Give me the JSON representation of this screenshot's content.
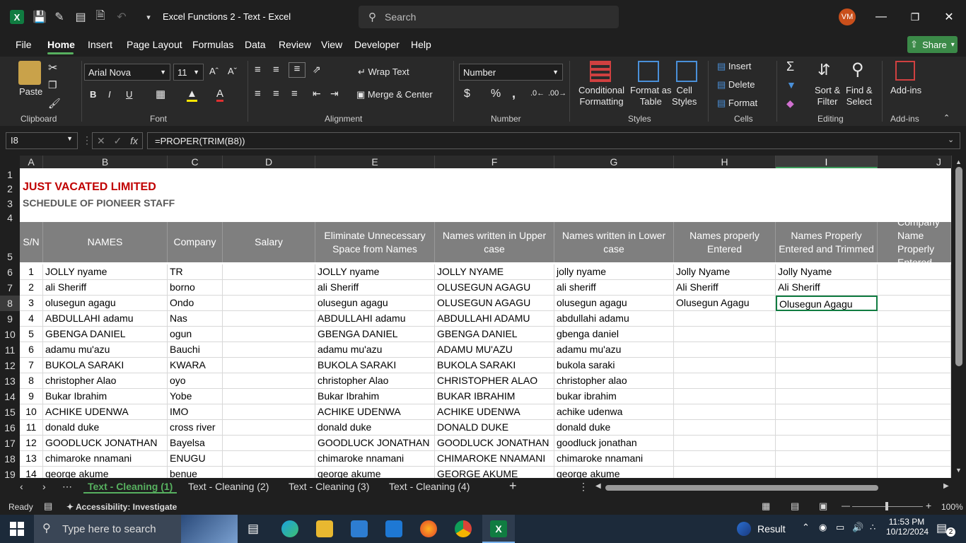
{
  "titlebar": {
    "doc_title": "Excel Functions 2 - Text  -  Excel",
    "search_placeholder": "Search",
    "avatar_initials": "VM"
  },
  "menu": [
    "File",
    "Home",
    "Insert",
    "Page Layout",
    "Formulas",
    "Data",
    "Review",
    "View",
    "Developer",
    "Help"
  ],
  "share_label": "Share",
  "ribbon": {
    "clipboard": {
      "paste": "Paste",
      "label": "Clipboard"
    },
    "font": {
      "name": "Arial Nova",
      "size": "11",
      "label": "Font"
    },
    "alignment": {
      "wrap": "Wrap Text",
      "merge": "Merge & Center",
      "label": "Alignment"
    },
    "number": {
      "format": "Number",
      "label": "Number",
      "dollar": "$",
      "percent": "%",
      "comma": ","
    },
    "styles": {
      "cond1": "Conditional",
      "cond2": "Formatting",
      "fmt1": "Format as",
      "fmt2": "Table",
      "cell1": "Cell",
      "cell2": "Styles",
      "label": "Styles"
    },
    "cells": {
      "insert": "Insert",
      "delete": "Delete",
      "format": "Format",
      "label": "Cells"
    },
    "editing": {
      "sort1": "Sort &",
      "sort2": "Filter",
      "find1": "Find &",
      "find2": "Select",
      "label": "Editing"
    },
    "addins": {
      "btn": "Add-ins",
      "label": "Add-ins"
    }
  },
  "formula_bar": {
    "cell_ref": "I8",
    "formula": "=PROPER(TRIM(B8))"
  },
  "columns": [
    "A",
    "B",
    "C",
    "D",
    "E",
    "F",
    "G",
    "H",
    "I",
    "J"
  ],
  "rows": [
    "1",
    "2",
    "3",
    "4",
    "5",
    "6",
    "7",
    "8",
    "9",
    "10",
    "11",
    "12",
    "13",
    "14",
    "15",
    "16",
    "17",
    "18",
    "19"
  ],
  "sheet": {
    "company_title": "JUST VACATED LIMITED",
    "subtitle": "SCHEDULE OF PIONEER STAFF",
    "headers": [
      "S/N",
      "NAMES",
      "Company",
      "Salary",
      "Eliminate Unnecessary Space from Names",
      "Names written in Upper case",
      "Names written in Lower case",
      "Names properly Entered",
      "Names Properly Entered and Trimmed",
      "Company Name Properly Entered"
    ],
    "data": [
      [
        "1",
        "JOLLY   nyame",
        "TR",
        "",
        "JOLLY nyame",
        "JOLLY NYAME",
        "jolly nyame",
        "Jolly   Nyame",
        "Jolly Nyame"
      ],
      [
        "2",
        "ali Sheriff",
        "borno",
        "",
        "ali Sheriff",
        "OLUSEGUN AGAGU",
        "ali sheriff",
        "Ali Sheriff",
        "Ali Sheriff"
      ],
      [
        "3",
        "olusegun agagu",
        "Ondo",
        "",
        "olusegun agagu",
        "OLUSEGUN AGAGU",
        "olusegun agagu",
        "Olusegun Agagu",
        "Olusegun Agagu"
      ],
      [
        "4",
        "ABDULLAHI      adamu",
        "Nas",
        "",
        "ABDULLAHI adamu",
        "ABDULLAHI ADAMU",
        "abdullahi adamu",
        "",
        ""
      ],
      [
        "5",
        "GBENGA DANIEL",
        "ogun",
        "",
        "GBENGA DANIEL",
        "GBENGA DANIEL",
        "gbenga daniel",
        "",
        ""
      ],
      [
        "6",
        "adamu mu'azu",
        "Bauchi",
        "",
        "adamu mu'azu",
        "ADAMU MU'AZU",
        "adamu mu'azu",
        "",
        ""
      ],
      [
        "7",
        "BUKOLA    SARAKI",
        "KWARA",
        "",
        "BUKOLA SARAKI",
        "BUKOLA SARAKI",
        "bukola saraki",
        "",
        ""
      ],
      [
        "8",
        "christopher Alao",
        "oyo",
        "",
        "christopher Alao",
        "CHRISTOPHER ALAO",
        "christopher alao",
        "",
        ""
      ],
      [
        "9",
        "Bukar Ibrahim",
        "Yobe",
        "",
        "Bukar Ibrahim",
        "BUKAR IBRAHIM",
        "bukar ibrahim",
        "",
        ""
      ],
      [
        "10",
        "ACHIKE UDENWA",
        "IMO",
        "",
        "ACHIKE UDENWA",
        "ACHIKE UDENWA",
        "achike udenwa",
        "",
        ""
      ],
      [
        "11",
        "donald       duke",
        "cross river",
        "",
        "donald duke",
        "DONALD DUKE",
        "donald duke",
        "",
        ""
      ],
      [
        "12",
        "GOODLUCK JONATHAN",
        "Bayelsa",
        "",
        "GOODLUCK JONATHAN",
        "GOODLUCK JONATHAN",
        "goodluck jonathan",
        "",
        ""
      ],
      [
        "13",
        "chimaroke     nnamani",
        "ENUGU",
        "",
        "chimaroke nnamani",
        "CHIMAROKE NNAMANI",
        "chimaroke nnamani",
        "",
        ""
      ],
      [
        "14",
        "george akume",
        "benue",
        "",
        "george akume",
        "GEORGE AKUME",
        "george akume",
        "",
        ""
      ]
    ]
  },
  "tabs": [
    "Text - Cleaning (1)",
    "Text - Cleaning (2)",
    "Text - Cleaning (3)",
    "Text - Cleaning (4)"
  ],
  "status": {
    "ready": "Ready",
    "accessibility": "Accessibility: Investigate",
    "zoom": "100%"
  },
  "taskbar": {
    "search": "Type here to search",
    "result": "Result",
    "time": "11:53 PM",
    "date": "10/12/2024",
    "notif": "2"
  }
}
